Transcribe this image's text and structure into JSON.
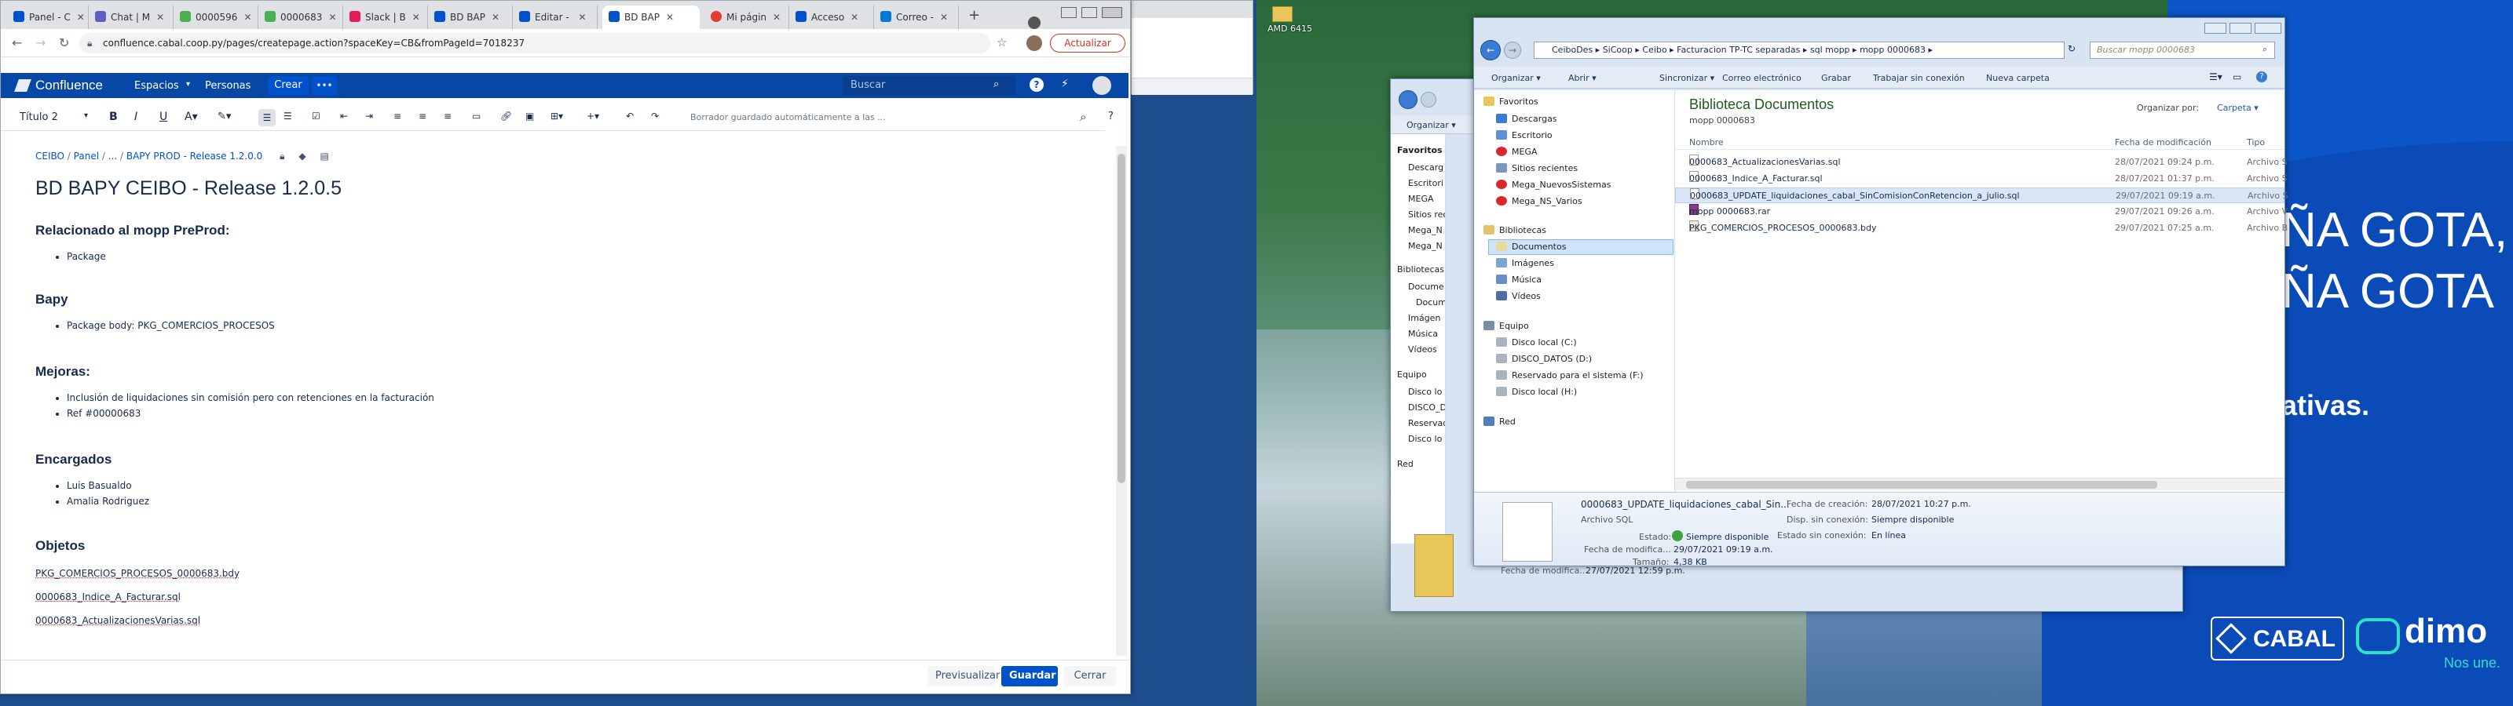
{
  "desktop": {
    "icon_label": "AMD 6415",
    "ad_lines": [
      "ÑA GOTA,",
      "ÑA GOTA",
      "ativas."
    ],
    "brand1": "CABAL",
    "brand2": "dimo",
    "brand2_tagline": "Nos une."
  },
  "chrome": {
    "tabs": [
      {
        "label": "Panel - C",
        "color": "#0052cc"
      },
      {
        "label": "Chat | M",
        "color": "#5b5fc7"
      },
      {
        "label": "0000596",
        "color": "#4caf50"
      },
      {
        "label": "0000683",
        "color": "#4caf50"
      },
      {
        "label": "Slack | B",
        "color": "#e01e5a"
      },
      {
        "label": "BD BAP",
        "color": "#0052cc"
      },
      {
        "label": "Editar - ",
        "color": "#0052cc"
      },
      {
        "label": "BD BAP",
        "color": "#0052cc"
      },
      {
        "label": "Mi págin",
        "color": "#e53935"
      },
      {
        "label": "Acceso",
        "color": "#0052cc"
      },
      {
        "label": "Correo -",
        "color": "#0078d4"
      }
    ],
    "new_tab": "+",
    "url": "confluence.cabal.coop.py/pages/createpage.action?spaceKey=CB&fromPageId=7018237",
    "update_button": "Actualizar"
  },
  "confluence": {
    "nav": {
      "logo": "Confluence",
      "spaces": "Espacios",
      "people": "Personas",
      "create": "Crear",
      "more": "•••",
      "search_placeholder": "Buscar"
    },
    "toolbar": {
      "style": "Título 2",
      "autosave": "Borrador guardado automáticamente a las ..."
    },
    "breadcrumb": [
      "CEIBO",
      "Panel",
      "...",
      "BAPY PROD - Release 1.2.0.0"
    ],
    "title": "BD BAPY CEIBO - Release 1.2.0.5",
    "sections": [
      {
        "heading": "Relacionado al mopp PreProd:",
        "items": [
          "Package"
        ]
      },
      {
        "heading": "Bapy",
        "items": [
          "Package body: PKG_COMERCIOS_PROCESOS"
        ]
      },
      {
        "heading": "Mejoras:",
        "items": [
          "Inclusión de liquidaciones sin comisión pero con retenciones en la facturación",
          "Ref #00000683"
        ]
      },
      {
        "heading": "Encargados",
        "items": [
          "Luis Basualdo",
          "Amalia Rodriguez"
        ]
      },
      {
        "heading": "Objetos",
        "items": []
      }
    ],
    "objects": [
      "PKG_COMERCIOS_PROCESOS_0000683.bdy",
      "0000683_Indice_A_Facturar.sql",
      "0000683_ActualizacionesVarias.sql"
    ],
    "footer": {
      "preview": "Previsualizar",
      "save": "Guardar",
      "close": "Cerrar"
    }
  },
  "explorer_front": {
    "path": [
      "CeiboDes",
      "SiCoop",
      "Ceibo",
      "Facturacion TP-TC separadas",
      "sql mopp",
      "mopp 0000683"
    ],
    "search_placeholder": "Buscar mopp 0000683",
    "toolbar": [
      "Organizar ▾",
      "Abrir ▾",
      "Sincronizar ▾",
      "Correo electrónico",
      "Grabar",
      "Trabajar sin conexión",
      "Nueva carpeta"
    ],
    "nav": {
      "favorites": "Favoritos",
      "fav_items": [
        "Descargas",
        "Escritorio",
        "MEGA",
        "Sitios recientes",
        "Mega_NuevosSistemas",
        "Mega_NS_Varios"
      ],
      "libraries": "Bibliotecas",
      "lib_items": [
        "Documentos",
        "Imágenes",
        "Música",
        "Vídeos"
      ],
      "computer": "Equipo",
      "comp_items": [
        "Disco local (C:)",
        "DISCO_DATOS (D:)",
        "Reservado para el sistema (F:)",
        "Disco local (H:)"
      ],
      "network": "Red"
    },
    "library_title": "Biblioteca Documentos",
    "library_subtitle": "mopp 0000683",
    "arrange_label": "Organizar por:",
    "arrange_value": "Carpeta ▾",
    "columns": [
      "Nombre",
      "Fecha de modificación",
      "Tipo"
    ],
    "files": [
      {
        "name": "0000683_ActualizacionesVarias.sql",
        "date": "28/07/2021 09:24 p.m.",
        "type": "Archivo S"
      },
      {
        "name": "0000683_Indice_A_Facturar.sql",
        "date": "28/07/2021 01:37 p.m.",
        "type": "Archivo S"
      },
      {
        "name": "0000683_UPDATE_liquidaciones_cabal_SinComisionConRetencion_a_julio.sql",
        "date": "29/07/2021 09:19 a.m.",
        "type": "Archivo S"
      },
      {
        "name": "mopp 0000683.rar",
        "date": "29/07/2021 09:26 a.m.",
        "type": "Archivo V"
      },
      {
        "name": "PKG_COMERCIOS_PROCESOS_0000683.bdy",
        "date": "29/07/2021 07:25 a.m.",
        "type": "Archivo B"
      }
    ],
    "details": {
      "name": "0000683_UPDATE_liquidaciones_cabal_Sin...",
      "type": "Archivo SQL",
      "state_label": "Estado:",
      "state_value": "Siempre disponible",
      "modified_label": "Fecha de modifica...",
      "modified_value": "29/07/2021 09:19 a.m.",
      "size_label": "Tamaño:",
      "size_value": "4,38 KB",
      "created_label": "Fecha de creación:",
      "created_value": "28/07/2021 10:27 p.m.",
      "offline_label": "Disp. sin conexión:",
      "offline_value": "Siempre disponible",
      "offline_state_label": "Estado sin conexión:",
      "offline_state_value": "En línea"
    }
  },
  "explorer_back": {
    "organize": "Organizar ▾",
    "nav_items": [
      "Favoritos",
      "Descarg",
      "Escritori",
      "MEGA",
      "Sitios rec",
      "Mega_N",
      "Mega_N",
      "Bibliotecas",
      "Docume",
      "Docum",
      "Imágen",
      "Música",
      "Vídeos",
      "Equipo",
      "Disco lo",
      "DISCO_D",
      "Reservad",
      "Disco lo",
      "Red"
    ],
    "modified_label": "Fecha de modifica...",
    "modified_value": "27/07/2021 12:59 p.m."
  }
}
